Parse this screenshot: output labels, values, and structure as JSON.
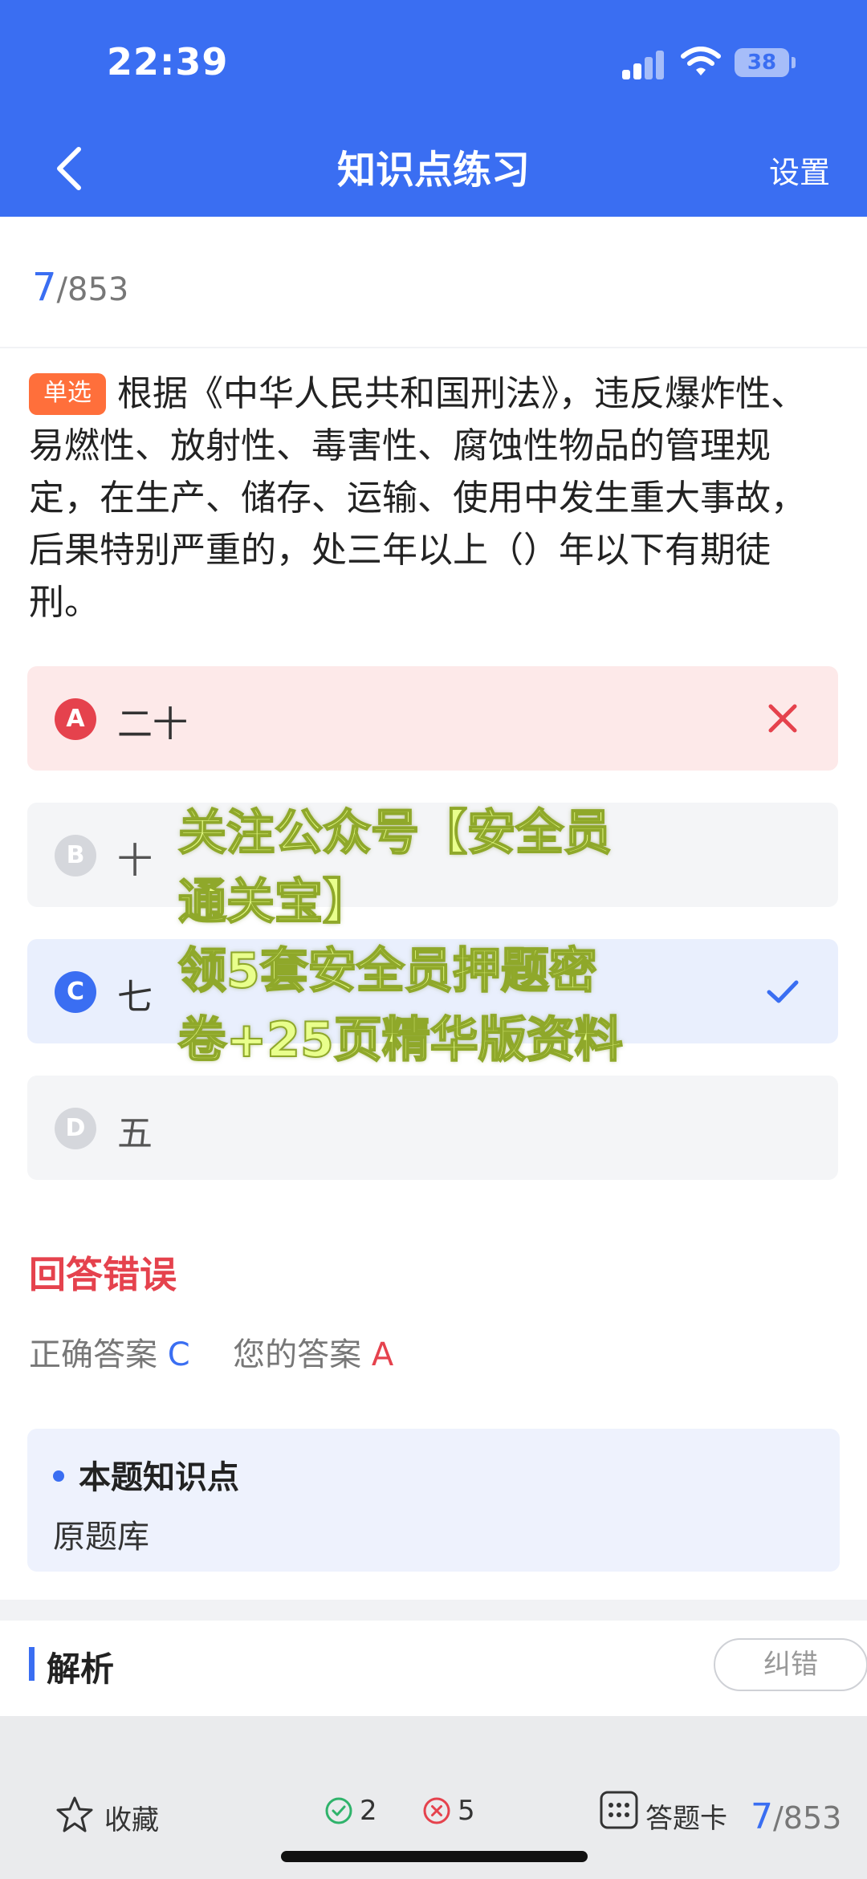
{
  "status_bar": {
    "time": "22:39",
    "battery": "38"
  },
  "nav": {
    "title": "知识点练习",
    "settings": "设置"
  },
  "progress": {
    "current": "7",
    "total": "/853"
  },
  "question": {
    "type_tag": "单选",
    "text": "根据《中华人民共和国刑法》，违反爆炸性、易燃性、放射性、毒害性、腐蚀性物品的管理规定，在生产、储存、运输、使用中发生重大事故，后果特别严重的，处三年以上（）年以下有期徒刑。"
  },
  "options": [
    {
      "letter": "A",
      "text": "二十",
      "state": "wrong"
    },
    {
      "letter": "B",
      "text": "十",
      "state": "normal"
    },
    {
      "letter": "C",
      "text": "七",
      "state": "correct"
    },
    {
      "letter": "D",
      "text": "五",
      "state": "normal"
    }
  ],
  "watermark": {
    "lines": [
      "关注公众号【安全员",
      "通关宝】",
      "领5套安全员押题密",
      "卷+25页精华版资料"
    ]
  },
  "result": {
    "title": "回答错误",
    "correct_label": "正确答案",
    "correct_value": "C",
    "yours_label": "您的答案",
    "yours_value": "A"
  },
  "knowledge_point": {
    "title": "本题知识点",
    "value": "原题库"
  },
  "analysis": {
    "title": "解析",
    "report_button": "纠错"
  },
  "bottom_bar": {
    "favorite_label": "收藏",
    "correct_count": "2",
    "wrong_count": "5",
    "answer_card_label": "答题卡",
    "progress_current": "7",
    "progress_total": "/853"
  },
  "colors": {
    "primary": "#3a6ef2",
    "error": "#e5424d",
    "tag": "#ff6f3b",
    "correct_green": "#2fb36b"
  }
}
